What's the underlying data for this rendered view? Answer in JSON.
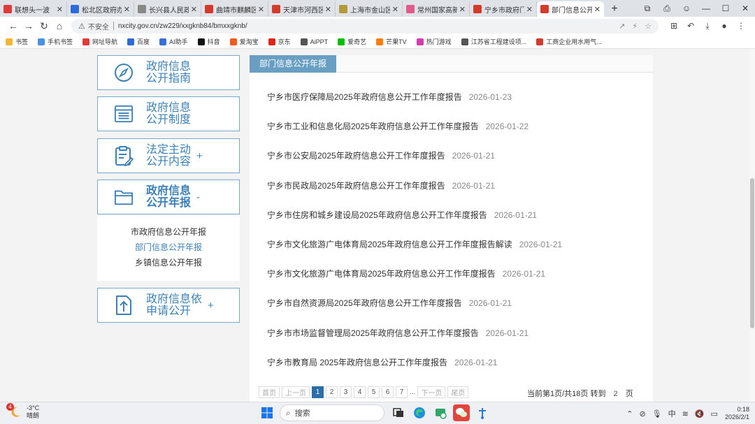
{
  "browser": {
    "tabs": [
      {
        "title": "联想头一波",
        "color": "#e13a3a"
      },
      {
        "title": "松北区政府办公",
        "color": "#2b6ad8"
      },
      {
        "title": "长兴县人民政府",
        "color": "#888888"
      },
      {
        "title": "曲靖市麒麟区",
        "color": "#d33a2c"
      },
      {
        "title": "天津市河西区",
        "color": "#d33a2c"
      },
      {
        "title": "上海市金山区",
        "color": "#b59a3b"
      },
      {
        "title": "常州国家高新区",
        "color": "#e05a8a"
      },
      {
        "title": "宁乡市政府门户",
        "color": "#d33a2c"
      },
      {
        "title": "部门信息公开年",
        "color": "#d33a2c",
        "active": true
      }
    ],
    "new_tab": "+",
    "address": {
      "insecure_label": "不安全",
      "url": "nxcity.gov.cn/zw229/xxgknb84/bmxxgknb/"
    },
    "bookmarks": [
      {
        "label": "书签",
        "color": "#f2b632"
      },
      {
        "label": "手机书签",
        "color": "#4a90e2"
      },
      {
        "label": "网址导航",
        "color": "#e13a3a"
      },
      {
        "label": "百度",
        "color": "#2b6ad8"
      },
      {
        "label": "AI助手",
        "color": "#3a6fd8"
      },
      {
        "label": "抖音",
        "color": "#111111"
      },
      {
        "label": "爱淘宝",
        "color": "#f25a1d"
      },
      {
        "label": "京东",
        "color": "#e1251b"
      },
      {
        "label": "AiPPT",
        "color": "#555555"
      },
      {
        "label": "爱奇艺",
        "color": "#00be06"
      },
      {
        "label": "芒果TV",
        "color": "#ff7d00"
      },
      {
        "label": "热门游戏",
        "color": "#d63ab0"
      },
      {
        "label": "江苏省工程建设项...",
        "color": "#555555"
      },
      {
        "label": "工商企业用水用气...",
        "color": "#d33a2c"
      }
    ]
  },
  "sidebar": {
    "items": [
      {
        "line1": "政府信息",
        "line2": "公开指南",
        "sign": ""
      },
      {
        "line1": "政府信息",
        "line2": "公开制度",
        "sign": ""
      },
      {
        "line1": "法定主动",
        "line2": "公开内容",
        "sign": "+"
      },
      {
        "line1": "政府信息",
        "line2": "公开年报",
        "sign": "-"
      },
      {
        "line1": "政府信息依",
        "line2": "申请公开",
        "sign": "+"
      }
    ],
    "submenu": [
      {
        "label": "市政府信息公开年报"
      },
      {
        "label": "部门信息公开年报",
        "active": true
      },
      {
        "label": "乡镇信息公开年报"
      }
    ]
  },
  "content": {
    "tab_label": "部门信息公开年报",
    "list": [
      {
        "title": "宁乡市医疗保障局2025年政府信息公开工作年度报告",
        "date": "2026-01-23"
      },
      {
        "title": "宁乡市工业和信息化局2025年政府信息公开工作年度报告",
        "date": "2026-01-22"
      },
      {
        "title": "宁乡市公安局2025年政府信息公开工作年度报告",
        "date": "2026-01-21"
      },
      {
        "title": "宁乡市民政局2025年政府信息公开工作年度报告",
        "date": "2026-01-21"
      },
      {
        "title": "宁乡市住房和城乡建设局2025年政府信息公开工作年度报告",
        "date": "2026-01-21"
      },
      {
        "title": "宁乡市文化旅游广电体育局2025年政府信息公开工作年度报告解读",
        "date": "2026-01-21"
      },
      {
        "title": "宁乡市文化旅游广电体育局2025年政府信息公开工作年度报告",
        "date": "2026-01-21"
      },
      {
        "title": "宁乡市自然资源局2025年政府信息公开工作年度报告",
        "date": "2026-01-21"
      },
      {
        "title": "宁乡市市场监督管理局2025年政府信息公开工作年度报告",
        "date": "2026-01-21"
      },
      {
        "title": "宁乡市教育局 2025年政府信息公开工作年度报告",
        "date": "2026-01-21"
      }
    ],
    "pager": {
      "first": "首页",
      "prev": "上一页",
      "pages": [
        "1",
        "2",
        "3",
        "4",
        "5",
        "6",
        "7"
      ],
      "current": "1",
      "dots": "...",
      "next": "下一页",
      "last": "尾页",
      "info": "当前第1页/共18页 转到",
      "goto_value": "2",
      "unit": "页"
    }
  },
  "taskbar": {
    "weather_badge": "4",
    "temperature": "-3°C",
    "condition": "晴朗",
    "search_label": "搜索",
    "ime": "中",
    "time": "0:18",
    "date": "2026/2/1"
  }
}
